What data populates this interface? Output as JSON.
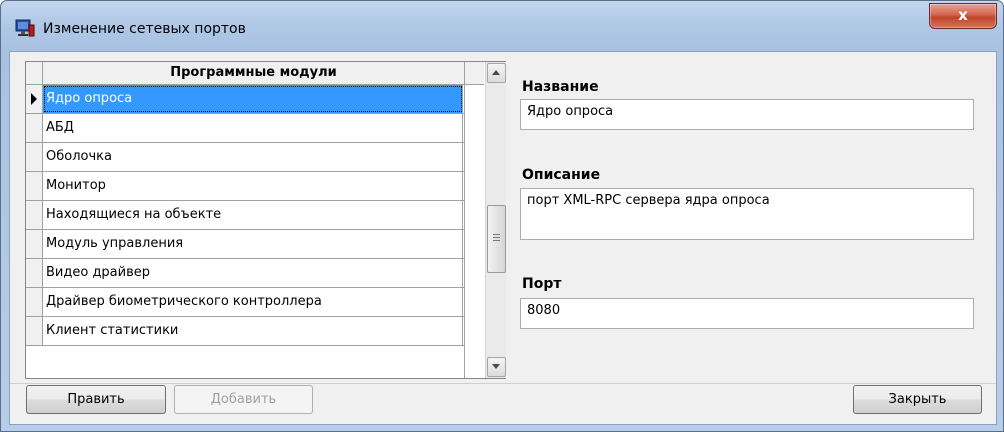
{
  "window": {
    "title": "Изменение сетевых портов",
    "close_label": "x"
  },
  "grid": {
    "header": "Программные модули",
    "rows": [
      {
        "label": "Ядро опроса",
        "selected": true
      },
      {
        "label": "АБД"
      },
      {
        "label": "Оболочка"
      },
      {
        "label": "Монитор"
      },
      {
        "label": "Находящиеся на объекте"
      },
      {
        "label": "Модуль управления"
      },
      {
        "label": "Видео драйвер"
      },
      {
        "label": "Драйвер биометрического контроллера"
      },
      {
        "label": "Клиент статистики"
      }
    ]
  },
  "details": {
    "name_label": "Название",
    "name_value": "Ядро опроса",
    "description_label": "Описание",
    "description_value": "порт XML-RPC сервера ядра опроса",
    "port_label": "Порт",
    "port_value": "8080"
  },
  "buttons": {
    "edit": "Править",
    "add": "Добавить",
    "close": "Закрыть"
  },
  "colors": {
    "selection": "#3399ff",
    "close_button": "#c1442a"
  }
}
